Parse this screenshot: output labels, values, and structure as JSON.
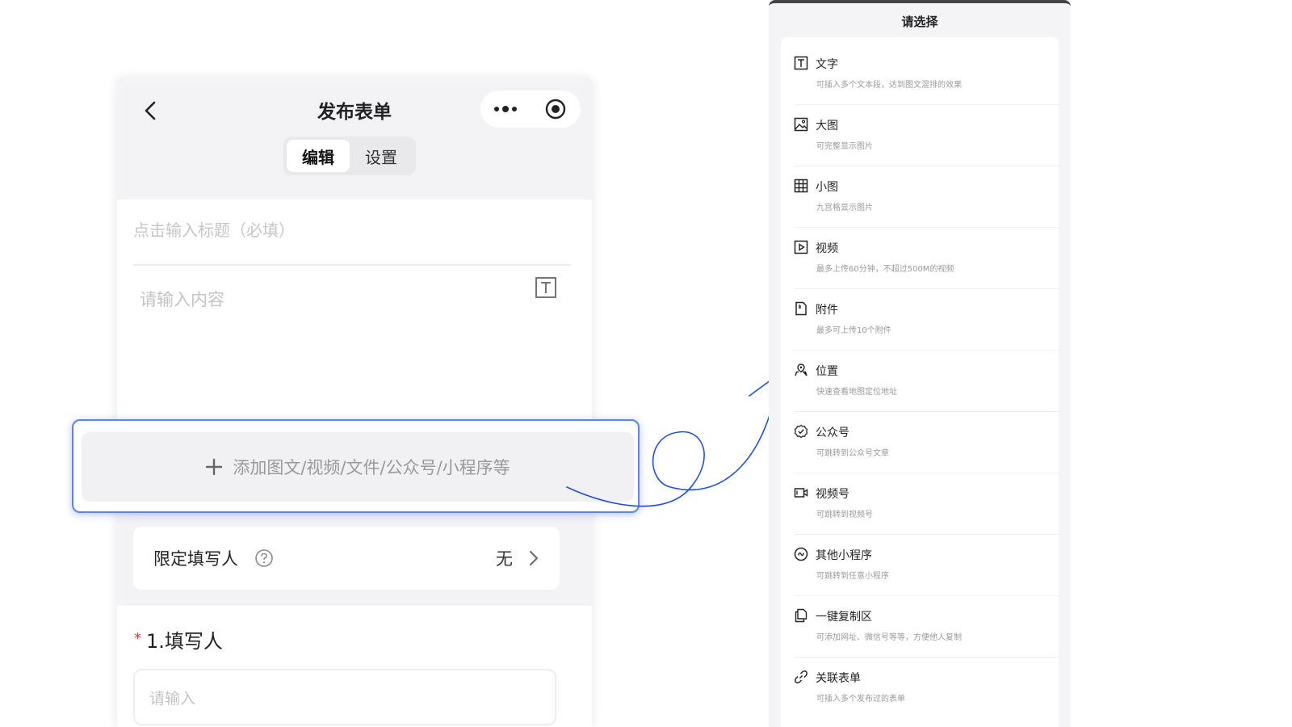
{
  "phone": {
    "nav_title": "发布表单",
    "tabs": [
      {
        "label": "编辑",
        "active": true
      },
      {
        "label": "设置",
        "active": false
      }
    ],
    "title_placeholder": "点击输入标题（必填）",
    "content_placeholder": "请输入内容",
    "add_button": {
      "icon": "plus-icon",
      "label": "添加图文/视频/文件/公众号/小程序等"
    },
    "restrict": {
      "label": "限定填写人",
      "value": "无"
    },
    "question": {
      "required_mark": "*",
      "title": "1.填写人",
      "placeholder": "请输入"
    }
  },
  "sheet": {
    "title": "请选择",
    "options": [
      {
        "icon": "text-icon",
        "title": "文字",
        "desc": "可插入多个文本段，达到图文混排的效果"
      },
      {
        "icon": "image-icon",
        "title": "大图",
        "desc": "可完整显示图片"
      },
      {
        "icon": "grid-icon",
        "title": "小图",
        "desc": "九宫格显示图片"
      },
      {
        "icon": "video-icon",
        "title": "视频",
        "desc": "最多上传60分钟，不超过500M的视频"
      },
      {
        "icon": "file-icon",
        "title": "附件",
        "desc": "最多可上传10个附件"
      },
      {
        "icon": "location-icon",
        "title": "位置",
        "desc": "快速查看地图定位地址"
      },
      {
        "icon": "official-account-icon",
        "title": "公众号",
        "desc": "可跳转到公众号文章"
      },
      {
        "icon": "video-channel-icon",
        "title": "视频号",
        "desc": "可跳转到视频号"
      },
      {
        "icon": "mini-program-icon",
        "title": "其他小程序",
        "desc": "可跳转到任意小程序"
      },
      {
        "icon": "copy-icon",
        "title": "一键复制区",
        "desc": "可添加网址、微信号等等，方便他人复制"
      },
      {
        "icon": "link-icon",
        "title": "关联表单",
        "desc": "可插入多个发布过的表单"
      }
    ]
  },
  "colors": {
    "accent": "#5b84f0",
    "annotation": "#1f4fe0",
    "required": "#e53935"
  }
}
